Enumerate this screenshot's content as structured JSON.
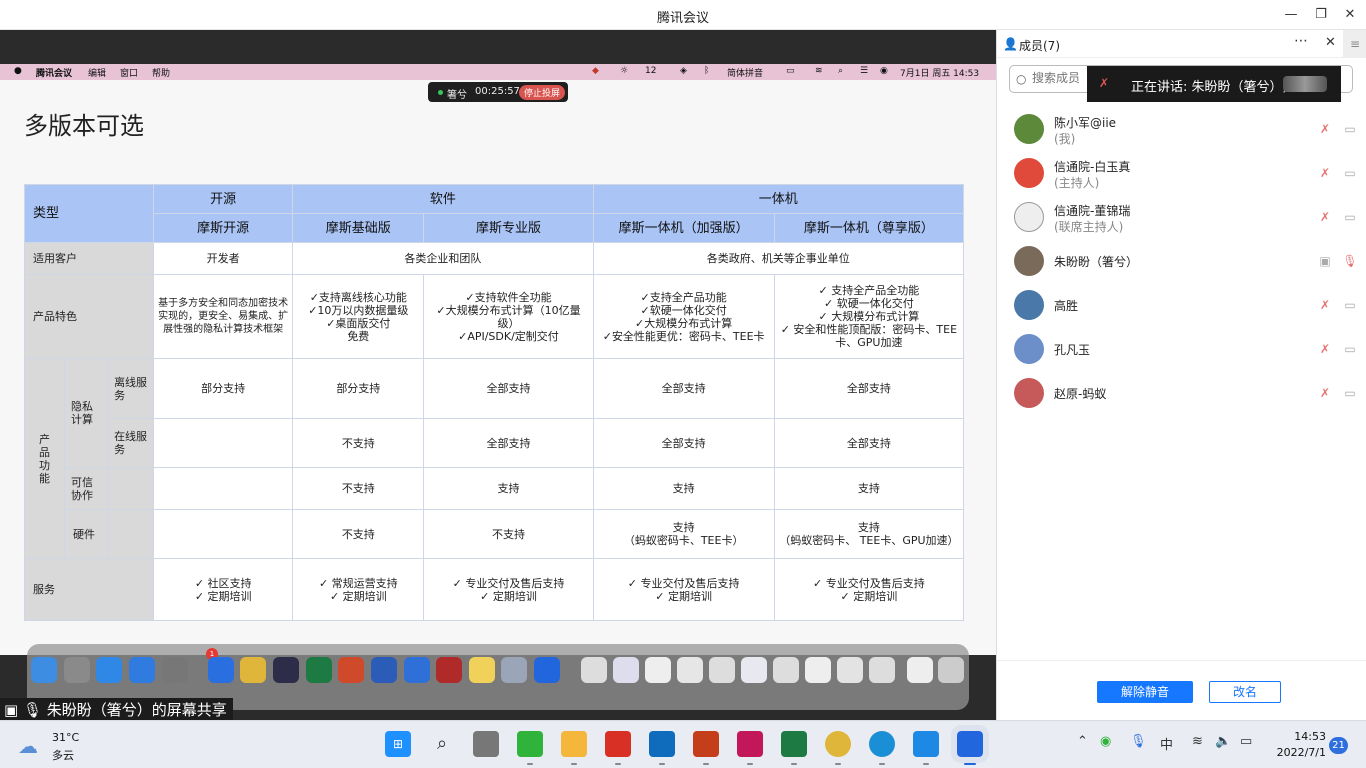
{
  "window": {
    "title": "腾讯会议"
  },
  "mac_menu": {
    "app": "腾讯会议",
    "items": [
      "编辑",
      "窗口",
      "帮助"
    ],
    "badge_12": "12",
    "ime": "简体拼音",
    "datetime": "7月1日 周五 14:53"
  },
  "share_pill": {
    "name": "箸兮",
    "time": "00:25:57",
    "stop_label": "停止投屏"
  },
  "slide": {
    "title": "多版本可选"
  },
  "table": {
    "h_type": "类型",
    "h_open": "开源",
    "h_soft": "软件",
    "h_box": "一体机",
    "p_open": "摩斯开源",
    "p_basic": "摩斯基础版",
    "p_pro": "摩斯专业版",
    "p_box_plus": "摩斯一体机（加强版）",
    "p_box_ex": "摩斯一体机（尊享版）",
    "cust_label": "适用客户",
    "cust_open": "开发者",
    "cust_soft": "各类企业和团队",
    "cust_box": "各类政府、机关等企事业单位",
    "feat_label": "产品特色",
    "feat_open": "基于多方安全和同态加密技术实现的，更安全、易集成、扩展性强的隐私计算技术框架",
    "feat_basic": "✓支持离线核心功能\n✓10万以内数据量级\n✓桌面版交付\n免费",
    "feat_pro": "✓支持软件全功能\n✓大规模分布式计算（10亿量级）\n✓API/SDK/定制交付",
    "feat_box_plus": "✓支持全产品功能\n✓软硬一体化交付\n✓大规模分布式计算\n✓安全性能更优：密码卡、TEE卡",
    "feat_box_ex": "✓  支持全产品全功能\n✓  软硬一体化交付\n✓  大规模分布式计算\n✓  安全和性能顶配版：密码卡、TEE卡、GPU加速",
    "func_label": "产品功能",
    "privacy_label": "隐私计算",
    "offline_label": "离线服务",
    "off_open": "部分支持",
    "off_basic": "部分支持",
    "off_pro": "全部支持",
    "off_box_plus": "全部支持",
    "off_box_ex": "全部支持",
    "online_label": "在线服务",
    "on_basic": "不支持",
    "on_pro": "全部支持",
    "on_box_plus": "全部支持",
    "on_box_ex": "全部支持",
    "trust_label": "可信协作",
    "tr_basic": "不支持",
    "tr_pro": "支持",
    "tr_box_plus": "支持",
    "tr_box_ex": "支持",
    "hw_label": "硬件",
    "hw_basic": "不支持",
    "hw_pro": "不支持",
    "hw_box_plus": "支持\n（蚂蚁密码卡、TEE卡）",
    "hw_box_ex": "支持\n（蚂蚁密码卡、 TEE卡、GPU加速）",
    "svc_label": "服务",
    "svc_open": "✓ 社区支持\n✓ 定期培训",
    "svc_basic": "✓ 常规运营支持\n✓ 定期培训",
    "svc_pro": "✓ 专业交付及售后支持\n✓ 定期培训",
    "svc_box_plus": "✓ 专业交付及售后支持\n✓ 定期培训",
    "svc_box_ex": "✓ 专业交付及售后支持\n✓ 定期培训"
  },
  "dock": {
    "badge": "1"
  },
  "share_label": "朱盼盼（箸兮）的屏幕共享",
  "panel": {
    "title": "成员(7)",
    "search_placeholder": "搜索成员",
    "speaking": "正在讲话: 朱盼盼（箸兮）;",
    "members": [
      {
        "name": "陈小军@iie",
        "role": "(我)"
      },
      {
        "name": "信通院-白玉真",
        "role": "(主持人)"
      },
      {
        "name": "信通院-董锦瑞",
        "role": "(联席主持人)"
      },
      {
        "name": "朱盼盼（箸兮）",
        "role": ""
      },
      {
        "name": "高胜",
        "role": ""
      },
      {
        "name": "孔凡玉",
        "role": ""
      },
      {
        "name": "赵原-蚂蚁",
        "role": ""
      }
    ],
    "unmute": "解除静音",
    "rename": "改名"
  },
  "taskbar": {
    "temp": "31°C",
    "weather": "多云",
    "ime": "中",
    "time": "14:53",
    "date": "2022/7/1",
    "notif": "21"
  }
}
